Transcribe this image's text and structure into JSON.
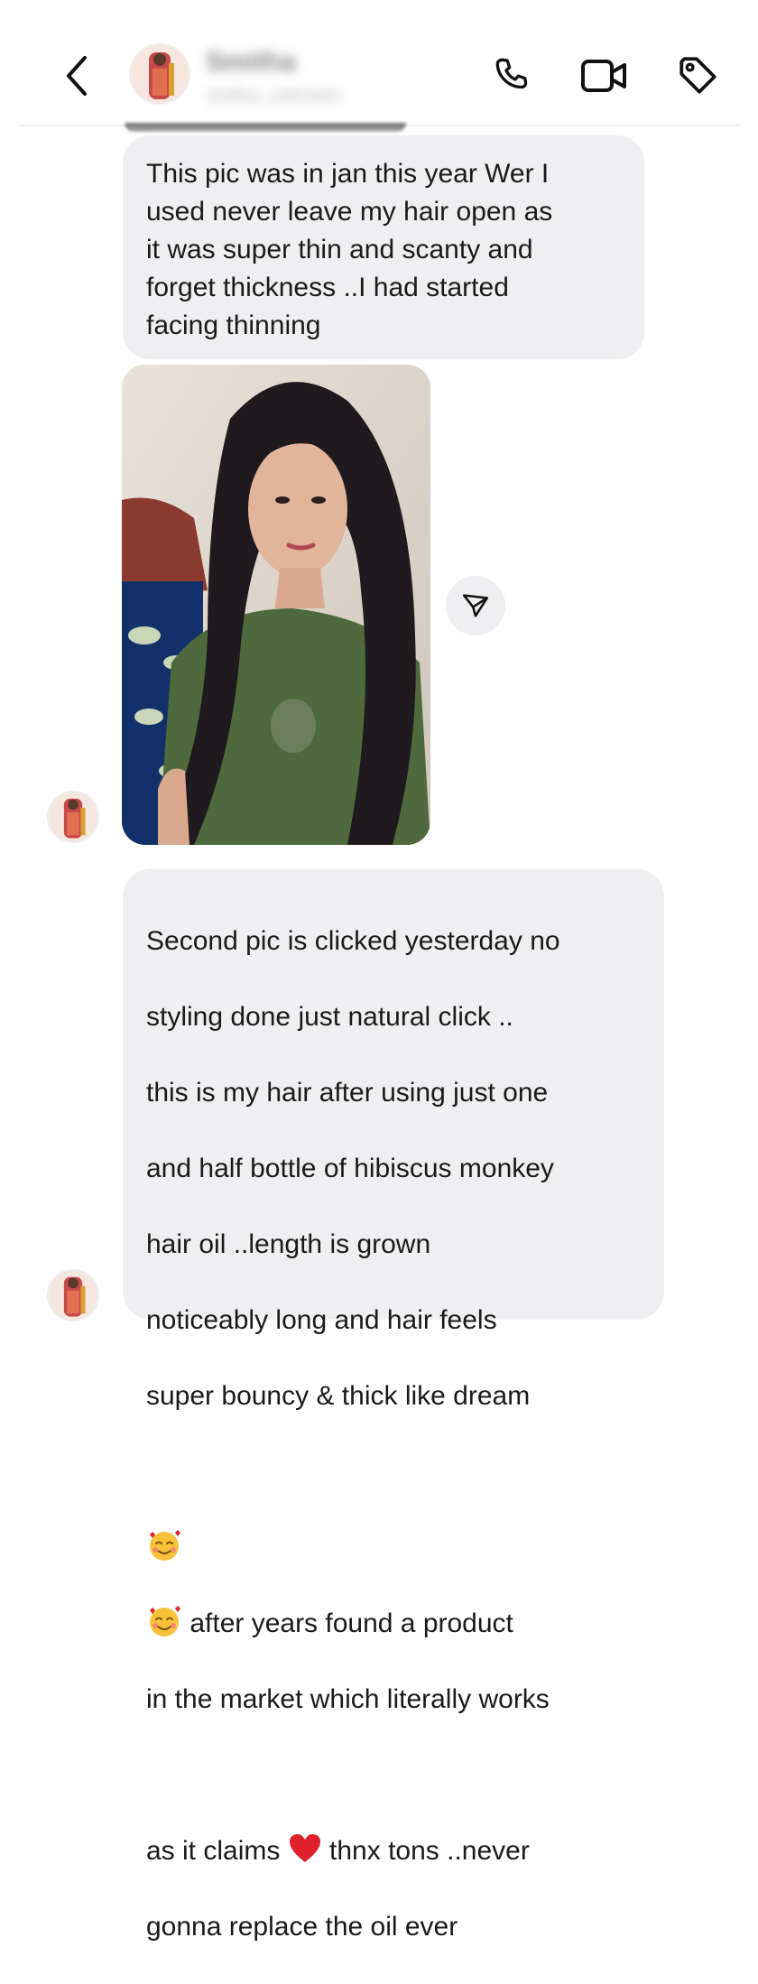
{
  "header": {
    "back_icon": "chevron-left-icon",
    "contact_name": "Smitha",
    "contact_handle": "smitha_unknown",
    "icons": [
      "phone-icon",
      "video-camera-icon",
      "tag-icon"
    ]
  },
  "messages": [
    {
      "type": "text",
      "text": "This pic was in jan this year Wer I\nused never leave my hair open as\nit was super thin and scanty and\nforget thickness ..I had started\nfacing thinning"
    },
    {
      "type": "image",
      "share_icon": "send-icon"
    },
    {
      "type": "text",
      "lines": {
        "l1": "Second pic is clicked yesterday no",
        "l2": "styling done just natural click ..",
        "l3": "this is my hair after using just one",
        "l4": "and half bottle of hibiscus monkey",
        "l5": "hair oil ..length is grown",
        "l6": "noticeably long and hair feels",
        "l7": "super bouncy & thick like dream",
        "l8_emoji": "🥰🥰",
        "l8": " after years found a product",
        "l9": "in the market which literally works",
        "l10a": "as it claims ",
        "l10_emoji": "❤️",
        "l10b": " thnx tons ..never",
        "l11": "gonna replace the oil ever"
      }
    }
  ],
  "colors": {
    "bubble": "#efeff1",
    "text": "#1a1a1a",
    "icon": "#111111",
    "heart": "#e0202a"
  }
}
